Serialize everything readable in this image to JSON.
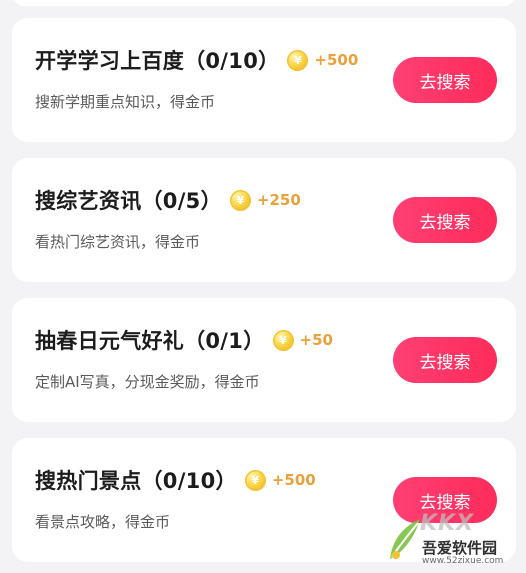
{
  "tasks": [
    {
      "title": "开学学习上百度（0/10）",
      "reward": "+500",
      "desc": "搜新学期重点知识，得金币",
      "button": "去搜索"
    },
    {
      "title": "搜综艺资讯（0/5）",
      "reward": "+250",
      "desc": "看热门综艺资讯，得金币",
      "button": "去搜索"
    },
    {
      "title": "抽春日元气好礼（0/1）",
      "reward": "+50",
      "desc": "定制AI写真，分现金奖励，得金币",
      "button": "去搜索"
    },
    {
      "title": "搜热门景点（0/10）",
      "reward": "+500",
      "desc": "看景点攻略，得金币",
      "button": "去搜索"
    }
  ],
  "coin_symbol": "¥",
  "watermark": {
    "brand": "KKX",
    "name": "吾爱软件园",
    "url": "www.52zixue.com"
  },
  "colors": {
    "button": "#ff2f5f",
    "reward": "#e8a13b",
    "coin": "#f8d648",
    "background": "#f3f3f5"
  }
}
